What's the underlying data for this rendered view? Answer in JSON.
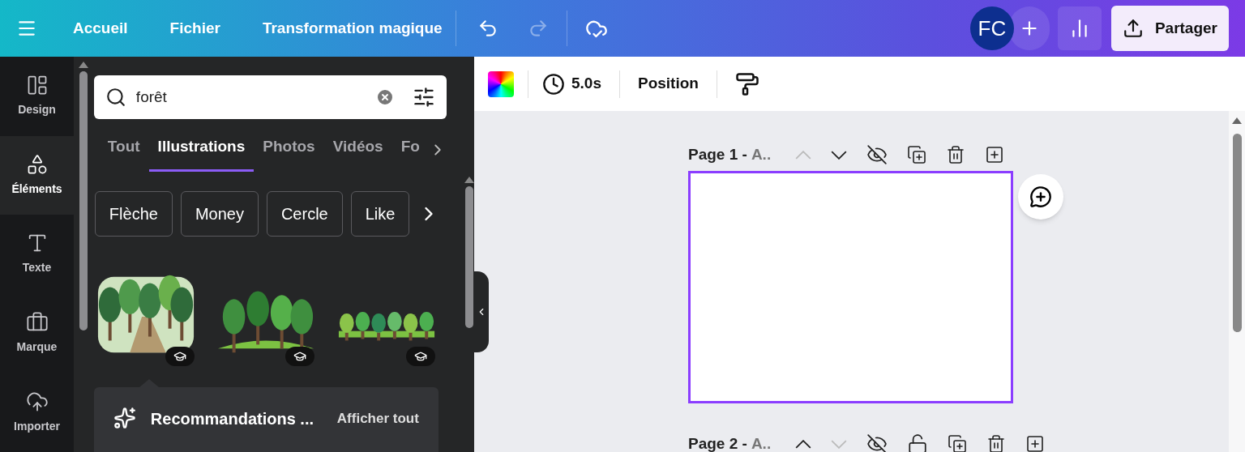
{
  "header": {
    "menu": [
      "Accueil",
      "Fichier",
      "Transformation magique"
    ],
    "undo": {
      "disabled": false
    },
    "redo": {
      "disabled": true
    },
    "avatar": "FC",
    "share": "Partager"
  },
  "rail": [
    {
      "label": "Design",
      "kind": "layout",
      "selected": false
    },
    {
      "label": "Éléments",
      "kind": "shapes",
      "selected": true
    },
    {
      "label": "Texte",
      "kind": "text",
      "selected": false
    },
    {
      "label": "Marque",
      "kind": "brand",
      "selected": false
    },
    {
      "label": "Importer",
      "kind": "upload",
      "selected": false
    }
  ],
  "search": {
    "value": "forêt"
  },
  "tabs": [
    {
      "label": "Tout",
      "selected": false
    },
    {
      "label": "Illustrations",
      "selected": true
    },
    {
      "label": "Photos",
      "selected": false
    },
    {
      "label": "Vidéos",
      "selected": false
    },
    {
      "label": "Fo",
      "selected": false
    }
  ],
  "chips": [
    "Flèche",
    "Money",
    "Cercle",
    "Like"
  ],
  "results": [
    {
      "kind": "picture",
      "premium": true
    },
    {
      "kind": "picture",
      "premium": true
    },
    {
      "kind": "picture",
      "premium": true
    }
  ],
  "recommendations": {
    "title": "Recommandations ...",
    "link": "Afficher tout"
  },
  "toolbar": {
    "duration": "5.0s",
    "position": "Position"
  },
  "pages": [
    {
      "label": "Page 1 -",
      "name": "A..",
      "up_disabled": true,
      "down_disabled": false,
      "lock_visible": false,
      "canvas": {
        "selected": true
      }
    },
    {
      "label": "Page 2 -",
      "name": "A..",
      "up_disabled": false,
      "down_disabled": true,
      "lock_visible": true
    }
  ]
}
